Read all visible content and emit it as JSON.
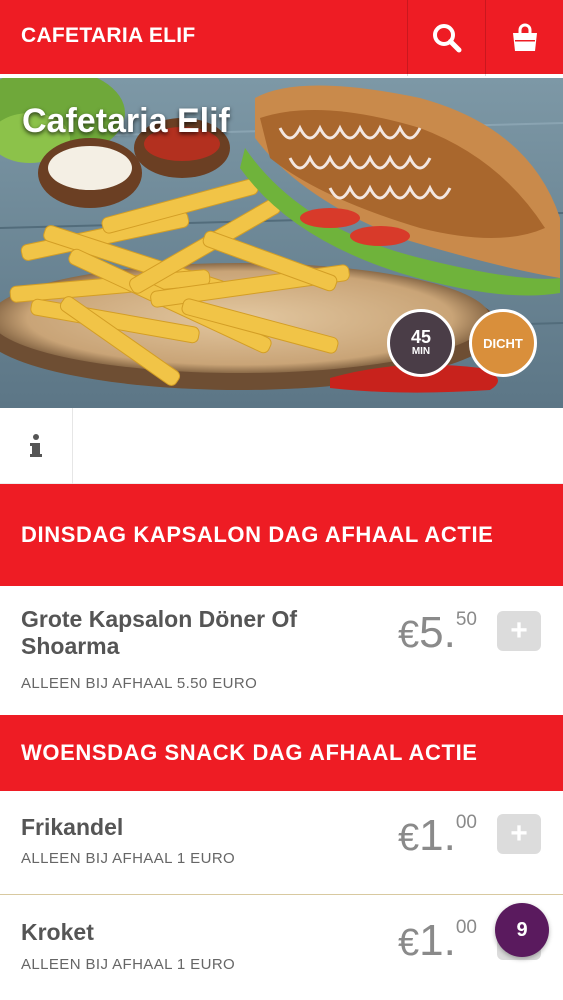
{
  "header": {
    "brand": "CAFETARIA ELIF",
    "search_icon": "search-icon",
    "cart_icon": "shopping-bag-icon"
  },
  "hero": {
    "title": "Cafetaria Elif",
    "delivery_time_value": "45",
    "delivery_time_unit": "MIN",
    "status": "DICHT"
  },
  "info": {
    "icon": "info-icon"
  },
  "categories": [
    {
      "title": "DINSDAG KAPSALON DAG AFHAAL ACTIE",
      "items": [
        {
          "name": "Grote Kapsalon Döner Of Shoarma",
          "description": "ALLEEN BIJ AFHAAL 5.50 EURO",
          "currency": "€",
          "price_whole": "5",
          "price_sep": ".",
          "price_cents": "50",
          "add_label": "+"
        }
      ]
    },
    {
      "title": "WOENSDAG SNACK DAG AFHAAL ACTIE",
      "items": [
        {
          "name": "Frikandel",
          "description": "ALLEEN BIJ AFHAAL 1 EURO",
          "currency": "€",
          "price_whole": "1",
          "price_sep": ".",
          "price_cents": "00",
          "add_label": "+"
        },
        {
          "name": "Kroket",
          "description": "ALLEEN BIJ AFHAAL 1 EURO",
          "currency": "€",
          "price_whole": "1",
          "price_sep": ".",
          "price_cents": "00",
          "add_label": "+"
        }
      ]
    }
  ],
  "cart": {
    "count": "9"
  },
  "colors": {
    "brand_red": "#ee1c24",
    "badge_dark": "#4a3d47",
    "badge_orange": "#d98f3b",
    "cart_purple": "#5a1a5e"
  }
}
